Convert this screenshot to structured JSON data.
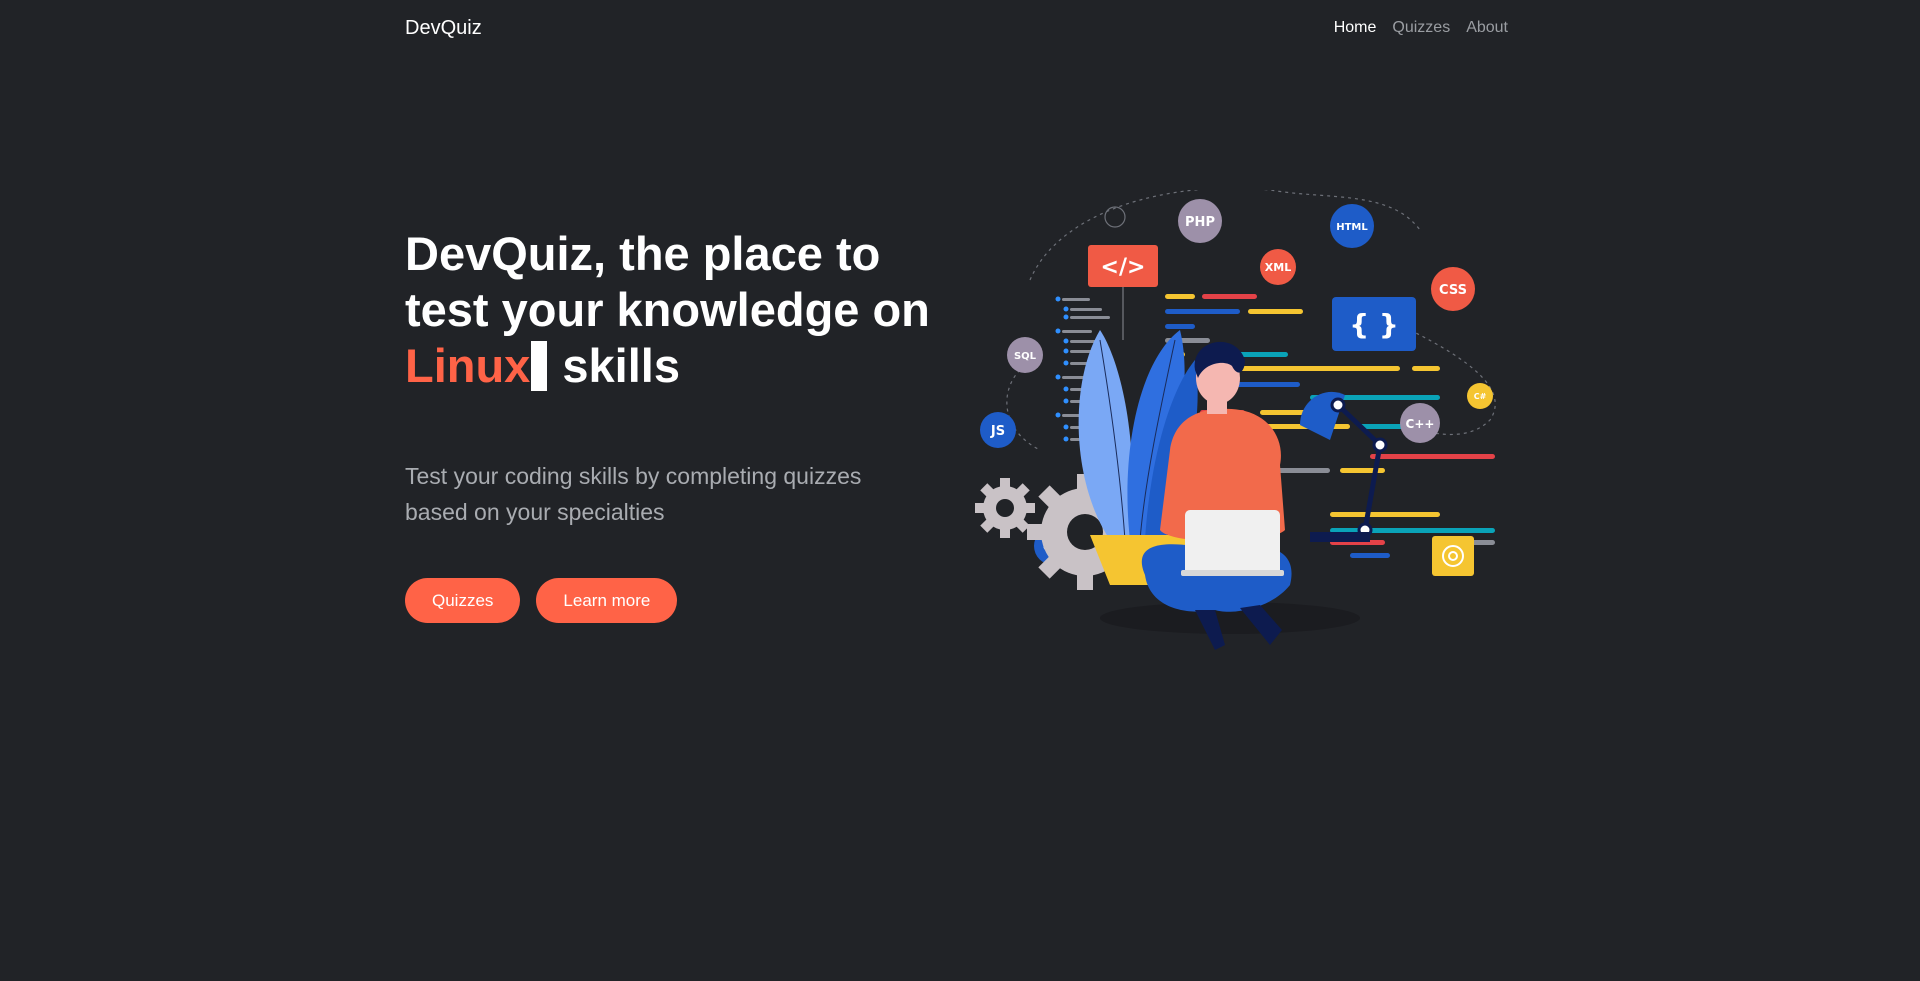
{
  "nav": {
    "brand": "DevQuiz",
    "links": [
      {
        "label": "Home",
        "active": true
      },
      {
        "label": "Quizzes",
        "active": false
      },
      {
        "label": "About",
        "active": false
      }
    ]
  },
  "hero": {
    "headline_part1": "DevQuiz, the place to test your knowledge on",
    "highlight": "Linux",
    "headline_part2": "skills",
    "subtitle": "Test your coding skills by completing quizzes based on your specialties",
    "primary_button": "Quizzes",
    "secondary_button": "Learn more"
  },
  "illustration": {
    "badges": [
      "PHP",
      "HTML",
      "XML",
      "CSS",
      "SQL",
      "JS",
      "C++",
      "C#",
      "C#"
    ],
    "code_tag": "</>",
    "braces": "{ }"
  },
  "colors": {
    "background": "#212327",
    "accent": "#ff6347",
    "muted_text": "#a9acb1"
  }
}
